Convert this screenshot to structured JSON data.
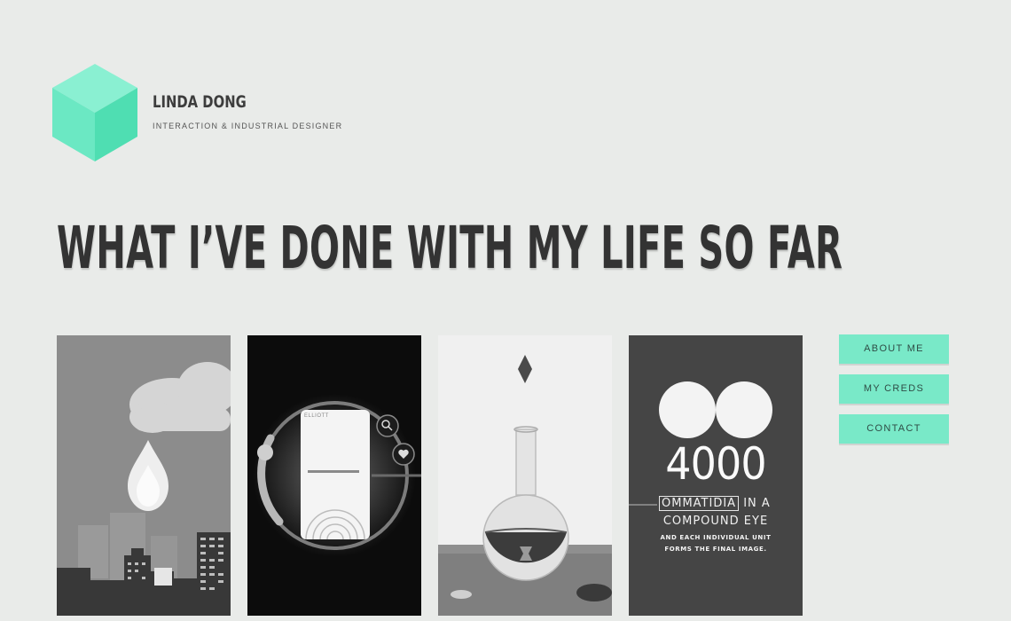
{
  "site": {
    "name": "LINDA DONG",
    "tagline": "INTERACTION & INDUSTRIAL DESIGNER"
  },
  "headline": "WHAT I’VE DONE WITH MY LIFE SO FAR",
  "nav": {
    "about": "ABOUT ME",
    "creds": "MY CREDS",
    "contact": "CONTACT"
  },
  "cards": {
    "app": {
      "label": "ELLIOTT"
    },
    "eye": {
      "number": "4000",
      "word_boxed": "OMMATIDIA",
      "word_rest": "IN A",
      "line2": "COMPOUND EYE",
      "sub1": "AND EACH INDIVIDUAL UNIT",
      "sub2": "FORMS THE FINAL IMAGE."
    }
  },
  "colors": {
    "background": "#e9ebe9",
    "accent": "#79e9c8",
    "headline": "#333333"
  }
}
